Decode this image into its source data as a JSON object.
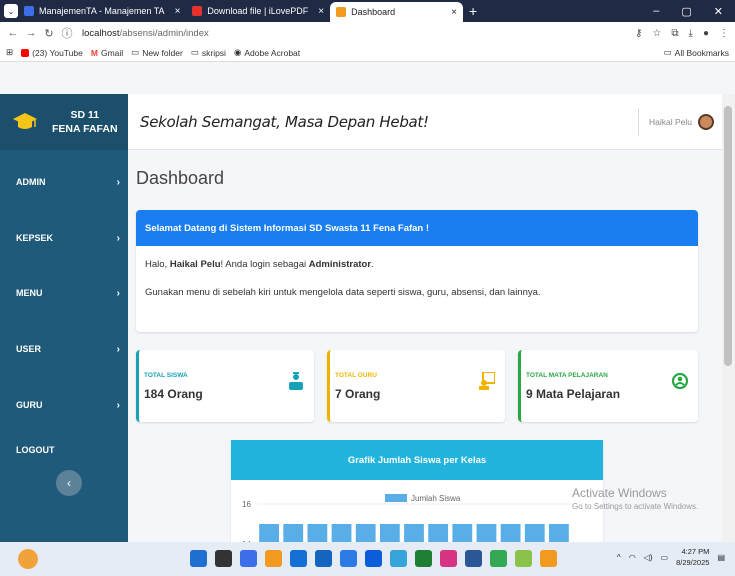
{
  "browser": {
    "tabs": [
      {
        "label": "ManajemenTA - Manajemen TA",
        "active": false,
        "fav_color": "#3b6ee8"
      },
      {
        "label": "Download file | iLovePDF",
        "active": false,
        "fav_color": "#e5322d"
      },
      {
        "label": "Dashboard",
        "active": true,
        "fav_color": "#f29a1f"
      }
    ],
    "tab_close": "×",
    "new_tab": "+",
    "url_host": "localhost",
    "url_path": "/absensi/admin/index",
    "bookmarks": [
      {
        "label": "(23) YouTube",
        "color": "#ff0000"
      },
      {
        "label": "Gmail",
        "color": "#ea4335"
      },
      {
        "label": "New folder",
        "color": "#666666"
      },
      {
        "label": "skripsi",
        "color": "#666666"
      },
      {
        "label": "Adobe Acrobat",
        "color": "#333333"
      }
    ],
    "all_bookmarks": "All Bookmarks"
  },
  "brand": {
    "line1": "SD 11",
    "line2": "FENA FAFAN"
  },
  "sidebar": {
    "items": [
      {
        "label": "ADMIN",
        "chevron": "›"
      },
      {
        "label": "KEPSEK",
        "chevron": "›"
      },
      {
        "label": "MENU",
        "chevron": "›"
      },
      {
        "label": "USER",
        "chevron": "›"
      },
      {
        "label": "GURU",
        "chevron": "›"
      },
      {
        "label": "LOGOUT",
        "chevron": ""
      }
    ],
    "toggle": "‹"
  },
  "topbar": {
    "slogan": "Sekolah Semangat, Masa Depan Hebat!",
    "user_name": "Haikal Pelu"
  },
  "page": {
    "title": "Dashboard"
  },
  "welcome": {
    "header": "Selamat Datang di Sistem Informasi SD Swasta 11 Fena Fafan !",
    "greet_prefix": "Halo, ",
    "greet_name": "Haikal Pelu",
    "greet_mid": "! Anda login sebagai ",
    "greet_role": "Administrator",
    "greet_end": ".",
    "instruction": "Gunakan menu di sebelah kiri untuk mengelola data seperti siswa, guru, absensi, dan lainnya."
  },
  "stats": [
    {
      "label": "TOTAL SISWA",
      "value": "184 Orang",
      "color": "#17a2b8"
    },
    {
      "label": "TOTAL GURU",
      "value": "7 Orang",
      "color": "#f0b400"
    },
    {
      "label": "TOTAL MATA PELAJARAN",
      "value": "9 Mata Pelajaran",
      "color": "#28a745"
    }
  ],
  "chart_card": {
    "title": "Grafik Jumlah Siswa per Kelas"
  },
  "chart_data": {
    "type": "bar",
    "title": "Grafik Jumlah Siswa per Kelas",
    "series": [
      {
        "name": "Jumlah Siswa",
        "values": [
          15,
          15,
          15,
          15,
          15,
          15,
          15,
          15,
          15,
          15,
          15,
          15,
          15
        ]
      }
    ],
    "yticks": [
      16,
      14
    ],
    "ylim": [
      13.5,
      16.8
    ],
    "bar_color": "#5aaee8"
  },
  "watermark": {
    "line1": "Activate Windows",
    "line2": "Go to Settings to activate Windows."
  },
  "taskbar": {
    "icon_colors": [
      "#1f6fd0",
      "#333333",
      "#3b6ee8",
      "#f29a1f",
      "#1570d6",
      "#1565c0",
      "#2c7be5",
      "#0b5ed7",
      "#36a3d9",
      "#1e7e34",
      "#d63384",
      "#2b5797",
      "#34a853",
      "#8bc34a",
      "#f29a1f"
    ],
    "time": "4:27 PM",
    "date": "8/29/2025"
  }
}
